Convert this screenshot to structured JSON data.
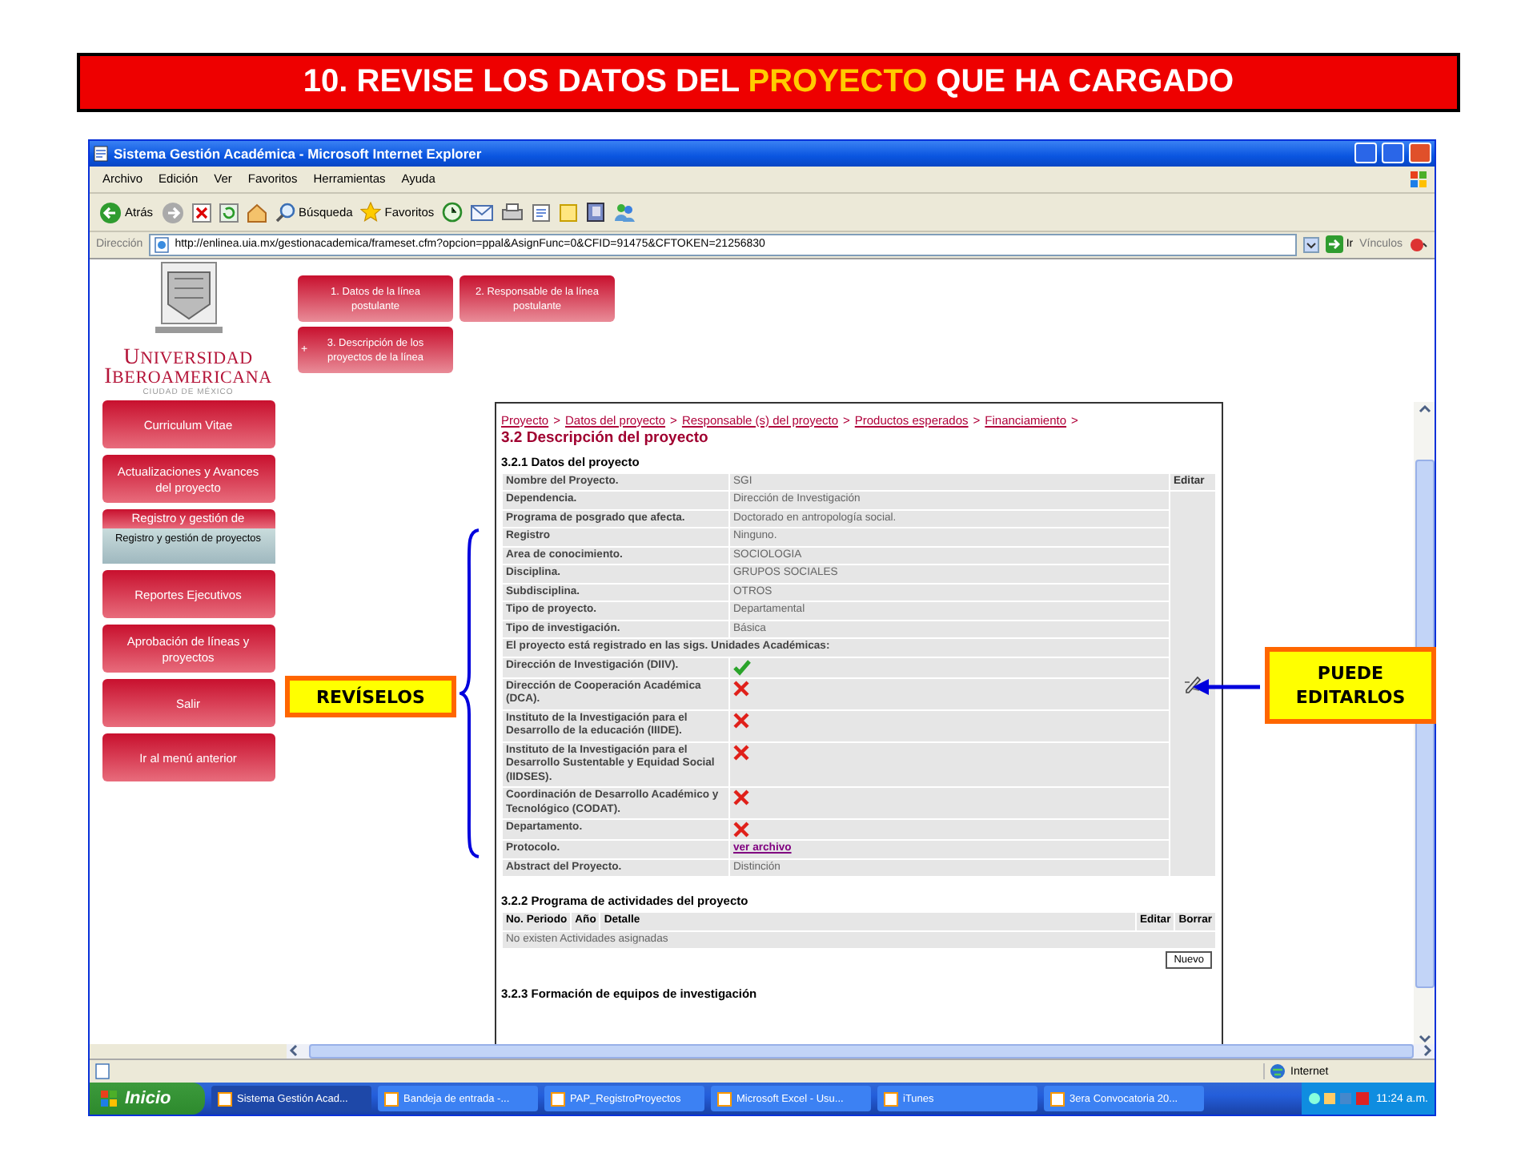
{
  "slide_title": [
    {
      "text": "10. REVISE LOS DATOS DEL ",
      "highlight": false
    },
    {
      "text": "PROYECTO",
      "highlight": true
    },
    {
      "text": " QUE HA CARGADO",
      "highlight": false
    }
  ],
  "window": {
    "title": "Sistema Gestión Académica - Microsoft Internet Explorer"
  },
  "menu": [
    "Archivo",
    "Edición",
    "Ver",
    "Favoritos",
    "Herramientas",
    "Ayuda"
  ],
  "toolbar": {
    "back": "Atrás",
    "search": "Búsqueda",
    "favorites": "Favoritos"
  },
  "address": {
    "label": "Dirección",
    "value": "http://enlinea.uia.mx/gestionacademica/frameset.cfm?opcion=ppal&AsignFunc=0&CFID=91475&CFTOKEN=21256830",
    "go": "Ir",
    "links": "Vínculos"
  },
  "logo": {
    "line_1": "UNIVERSIDAD",
    "line_2": "IBEROAMERICANA",
    "city": "CIUDAD DE MÉXICO"
  },
  "sidebar": {
    "items": [
      {
        "label": "Curriculum Vitae"
      },
      {
        "label": "Actualizaciones y Avances del proyecto"
      },
      {
        "label": "Registro y gestión de",
        "tooltip": "Registro y gestión de proyectos"
      },
      {
        "label": "Reportes Ejecutivos"
      },
      {
        "label": "Aprobación de líneas y proyectos"
      },
      {
        "label": "Salir"
      },
      {
        "label": "Ir al menú anterior"
      }
    ]
  },
  "tabs": [
    {
      "label": "1. Datos de la línea postulante"
    },
    {
      "label": "2. Responsable de la línea postulante"
    },
    {
      "label": "3. Descripción de los proyectos de la línea",
      "marker": "+"
    }
  ],
  "breadcrumb": {
    "items": [
      "Proyecto",
      "Datos del proyecto",
      "Responsable (s) del proyecto",
      "Productos esperados",
      "Financiamiento"
    ],
    "separator": ">"
  },
  "heading": "3.2 Descripción del proyecto",
  "project_data": {
    "title": "3.2.1 Datos del proyecto",
    "edit_header": "Editar",
    "rows": [
      {
        "kind": "text",
        "label": "Nombre del Proyecto.",
        "value": "SGI"
      },
      {
        "kind": "text",
        "label": "Dependencia.",
        "value": "Dirección de Investigación"
      },
      {
        "kind": "text",
        "label": "Programa de posgrado que afecta.",
        "value": "Doctorado en antropología social."
      },
      {
        "kind": "text",
        "label": "Registro",
        "value": "Ninguno."
      },
      {
        "kind": "text",
        "label": "Area de conocimiento.",
        "value": "SOCIOLOGIA"
      },
      {
        "kind": "text",
        "label": "Disciplina.",
        "value": "GRUPOS SOCIALES"
      },
      {
        "kind": "text",
        "label": "Subdisciplina.",
        "value": "OTROS"
      },
      {
        "kind": "text",
        "label": "Tipo de proyecto.",
        "value": "Departamental"
      },
      {
        "kind": "text",
        "label": "Tipo de investigación.",
        "value": "Básica"
      },
      {
        "kind": "heading",
        "label": "El proyecto está registrado en las sigs. Unidades Académicas:"
      },
      {
        "kind": "check",
        "label": "Dirección de Investigación (DIIV).",
        "registered": true
      },
      {
        "kind": "check",
        "label": "Dirección de Cooperación Académica (DCA).",
        "registered": false
      },
      {
        "kind": "check",
        "label": "Instituto de la Investigación para el Desarrollo de la educación (IIIDE).",
        "registered": false
      },
      {
        "kind": "check",
        "label": "Instituto de la Investigación para el Desarrollo Sustentable y Equidad Social (IIDSES).",
        "registered": false
      },
      {
        "kind": "check",
        "label": "Coordinación de Desarrollo Académico y Tecnológico (CODAT).",
        "registered": false
      },
      {
        "kind": "check",
        "label": "Departamento.",
        "registered": false
      },
      {
        "kind": "link",
        "label": "Protocolo.",
        "value": "ver archivo"
      },
      {
        "kind": "text",
        "label": "Abstract del Proyecto.",
        "value": "Distinción"
      }
    ]
  },
  "activities": {
    "title": "3.2.2 Programa de actividades del proyecto",
    "columns": [
      "No. Periodo",
      "Año",
      "Detalle",
      "Editar",
      "Borrar"
    ],
    "empty_message": "No existen Actividades asignadas",
    "new_button": "Nuevo"
  },
  "teams": {
    "title": "3.2.3 Formación de equipos de investigación"
  },
  "callouts": {
    "review": "REVÍSELOS",
    "edit": "PUEDE EDITARLOS"
  },
  "status_bar": {
    "zone": "Internet"
  },
  "taskbar": {
    "start": "Inicio",
    "tasks": [
      {
        "label": "Sistema Gestión Acad...",
        "selected": true
      },
      {
        "label": "Bandeja de entrada -...",
        "selected": false
      },
      {
        "label": "PAP_RegistroProyectos",
        "selected": false
      },
      {
        "label": "Microsoft Excel - Usu...",
        "selected": false
      },
      {
        "label": "iTunes",
        "selected": false
      },
      {
        "label": "3era Convocatoria 20...",
        "selected": false
      }
    ],
    "clock": "11:24 a.m."
  }
}
